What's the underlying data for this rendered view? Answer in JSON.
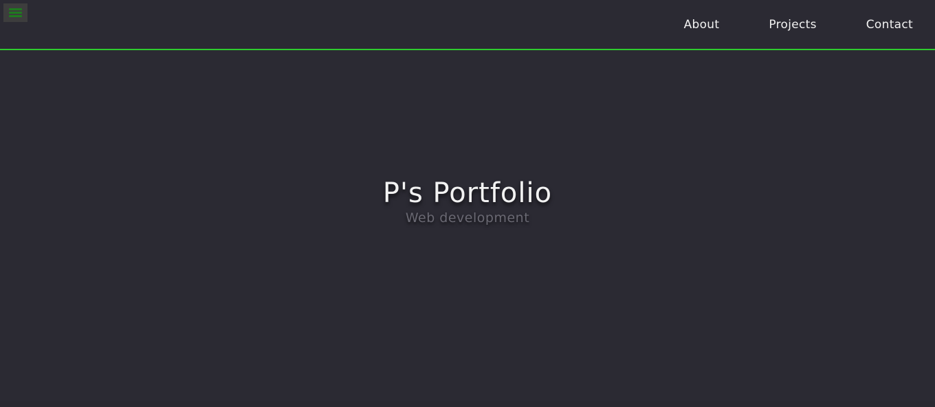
{
  "nav": {
    "menu_icon": "hamburger-menu-icon",
    "links": [
      {
        "label": "About"
      },
      {
        "label": "Projects"
      },
      {
        "label": "Contact"
      }
    ]
  },
  "hero": {
    "title": "P's Portfolio",
    "subtitle": "Web development"
  },
  "colors": {
    "background": "#2b2a33",
    "accent_border": "#2ecc2e",
    "menu_icon_bars": "#1f7a1f",
    "menu_button_bg": "#3d3d3d",
    "text_primary": "#f2f2f2",
    "text_secondary": "#6a6973"
  }
}
